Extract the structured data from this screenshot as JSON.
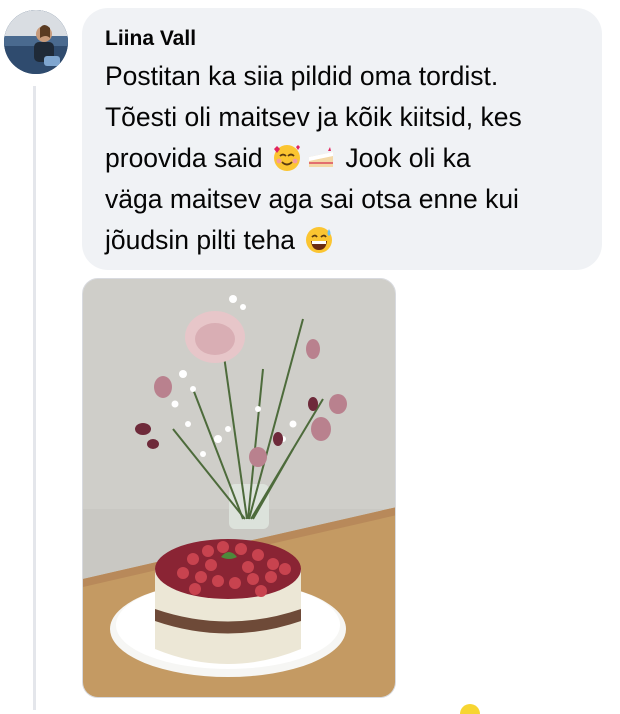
{
  "comment": {
    "author": "Liina Vall",
    "text_part1": "Postitan ka siia pildid oma tordist.\nTõesti oli maitsev ja kõik kiitsid, kes\nproovida said",
    "emoji1": "smiling-face-with-hearts",
    "emoji2": "cake-slice",
    "text_part2": " Jook oli ka\nväga maitsev aga sai otsa enne kui\njõudsin pilti teha",
    "emoji3": "grinning-sweat"
  },
  "colors": {
    "bubble": "#f0f2f5",
    "text": "#050505",
    "thread_line": "#e4e6eb"
  }
}
